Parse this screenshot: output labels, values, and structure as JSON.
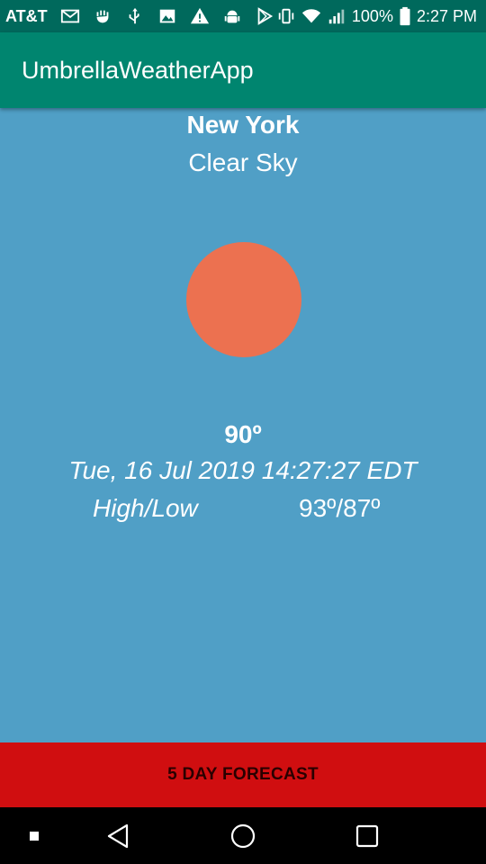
{
  "status_bar": {
    "carrier": "AT&T",
    "icons_left": [
      "gmail-icon",
      "hand-icon",
      "usb-icon",
      "image-icon",
      "warning-icon",
      "android-debug-icon",
      "play-store-icon"
    ],
    "icons_right": [
      "vibrate-icon",
      "wifi-icon",
      "signal-icon",
      "battery-icon"
    ],
    "battery_percent": "100%",
    "time": "2:27 PM"
  },
  "app_bar": {
    "title": "UmbrellaWeatherApp"
  },
  "weather": {
    "city": "New York",
    "condition": "Clear Sky",
    "condition_icon": "sun-circle",
    "temperature": "90º",
    "datetime": "Tue, 16 Jul 2019 14:27:27 EDT",
    "high_low_label": "High/Low",
    "high_low_value": "93º/87º"
  },
  "forecast_button": {
    "label": "5 DAY FORECAST"
  },
  "nav_bar": {
    "buttons": [
      "recent-apps-dot",
      "back",
      "home",
      "overview"
    ]
  },
  "colors": {
    "status_bar": "#00695c",
    "app_bar": "#00856f",
    "background": "#509fc6",
    "sun": "#ec7150",
    "forecast_button": "#d00e10",
    "nav_bar": "#000000",
    "text": "#ffffff"
  }
}
